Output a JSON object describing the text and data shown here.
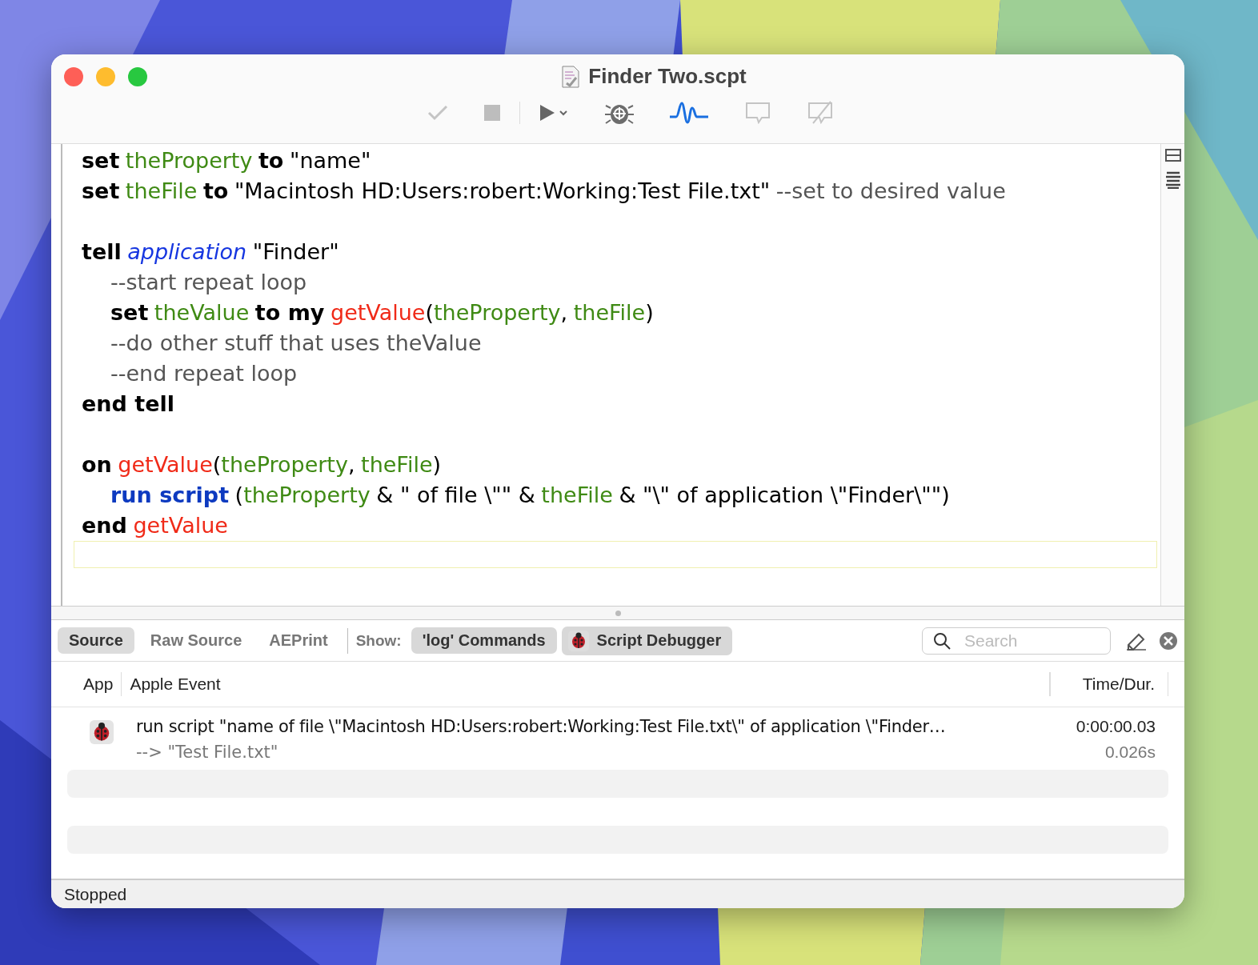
{
  "window": {
    "title": "Finder Two.scpt"
  },
  "code": [
    {
      "kind": "code",
      "tokens": [
        {
          "kind": "keyword",
          "text": "set"
        },
        {
          "kind": "variable",
          "text": "theProperty"
        },
        {
          "kind": "keyword",
          "text": "to"
        },
        {
          "kind": "plain",
          "text": "\"name\""
        }
      ]
    },
    {
      "kind": "code",
      "tokens": [
        {
          "kind": "keyword",
          "text": "set"
        },
        {
          "kind": "variable",
          "text": "theFile"
        },
        {
          "kind": "keyword",
          "text": "to"
        },
        {
          "kind": "plain",
          "text": "\"Macintosh HD:Users:robert:Working:Test File.txt\""
        },
        {
          "kind": "comment",
          "text": "--set to desired value"
        }
      ]
    },
    {
      "kind": "blank"
    },
    {
      "kind": "code",
      "tokens": [
        {
          "kind": "keyword",
          "text": "tell"
        },
        {
          "kind": "class",
          "text": "application"
        },
        {
          "kind": "plain",
          "text": "\"Finder\""
        }
      ],
      "children": [
        {
          "kind": "code",
          "tokens": [
            {
              "kind": "comment",
              "text": "--start repeat loop"
            }
          ]
        },
        {
          "kind": "code",
          "tokens": [
            {
              "kind": "keyword",
              "text": "set"
            },
            {
              "kind": "variable",
              "text": "theValue"
            },
            {
              "kind": "keyword",
              "text": "to my"
            },
            {
              "kind": "handler",
              "text": "getValue",
              "tight": false
            },
            {
              "kind": "plain",
              "text": "(",
              "tight": true
            },
            {
              "kind": "variable",
              "text": "theProperty",
              "tight": true
            },
            {
              "kind": "plain",
              "text": ",",
              "tight": true
            },
            {
              "kind": "variable",
              "text": "theFile"
            },
            {
              "kind": "plain",
              "text": ")",
              "tight": true
            }
          ]
        },
        {
          "kind": "code",
          "tokens": [
            {
              "kind": "comment",
              "text": "--do other stuff that uses theValue"
            }
          ]
        },
        {
          "kind": "code",
          "tokens": [
            {
              "kind": "comment",
              "text": "--end repeat loop"
            }
          ]
        }
      ]
    },
    {
      "kind": "code",
      "tokens": [
        {
          "kind": "keyword",
          "text": "end tell"
        }
      ]
    },
    {
      "kind": "blank"
    },
    {
      "kind": "code",
      "tokens": [
        {
          "kind": "keyword",
          "text": "on"
        },
        {
          "kind": "handler",
          "text": "getValue"
        },
        {
          "kind": "plain",
          "text": "(",
          "tight": true
        },
        {
          "kind": "variable",
          "text": "theProperty",
          "tight": true
        },
        {
          "kind": "plain",
          "text": ",",
          "tight": true
        },
        {
          "kind": "variable",
          "text": "theFile"
        },
        {
          "kind": "plain",
          "text": ")",
          "tight": true
        }
      ],
      "children": [
        {
          "kind": "code",
          "tokens": [
            {
              "kind": "command",
              "text": "run script"
            },
            {
              "kind": "plain",
              "text": "("
            },
            {
              "kind": "variable",
              "text": "theProperty",
              "tight": true
            },
            {
              "kind": "plain",
              "text": "& \" of file \\\"\" &"
            },
            {
              "kind": "variable",
              "text": "theFile"
            },
            {
              "kind": "plain",
              "text": "& \"\\\" of application \\\"Finder\\\"\")"
            }
          ]
        }
      ]
    },
    {
      "kind": "code",
      "tokens": [
        {
          "kind": "keyword",
          "text": "end"
        },
        {
          "kind": "handler",
          "text": "getValue"
        }
      ]
    }
  ],
  "log_tabs": [
    {
      "label": "Source",
      "selected": true
    },
    {
      "label": "Raw Source",
      "selected": false
    },
    {
      "label": "AEPrint",
      "selected": false
    }
  ],
  "show_label": "Show:",
  "show_toggles": [
    {
      "label": "'log' Commands",
      "on": true,
      "kind": "text"
    },
    {
      "label": "Script Debugger",
      "on": true,
      "kind": "app"
    }
  ],
  "search": {
    "placeholder": "Search"
  },
  "log_table": {
    "columns": [
      "App",
      "Apple Event",
      "Time/Dur."
    ],
    "rows": [
      {
        "event": "run script \"name of file \\\"Macintosh HD:Users:robert:Working:Test File.txt\\\" of application \\\"Finder…",
        "result": "--> \"Test File.txt\"",
        "time": "0:00:00.03",
        "duration": "0.026s"
      }
    ]
  },
  "status_bar": "Stopped"
}
